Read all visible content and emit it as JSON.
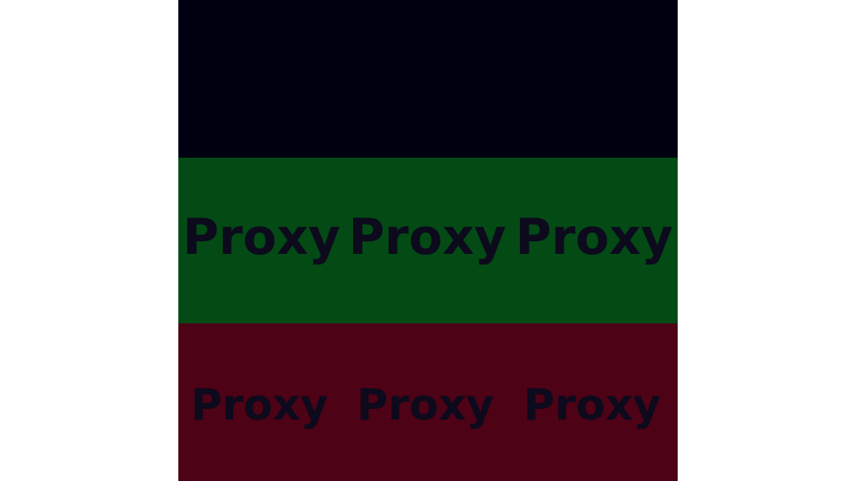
{
  "colors": {
    "page_background": "#ffffff",
    "band_top": "#000011",
    "band_middle": "#034a15",
    "band_bottom": "#4d0215",
    "text": "#0c0a1c"
  },
  "bands": {
    "middle": {
      "words": [
        "Proxy",
        "Proxy",
        "Proxy"
      ]
    },
    "bottom": {
      "words": [
        "Proxy",
        "Proxy",
        "Proxy"
      ]
    }
  }
}
